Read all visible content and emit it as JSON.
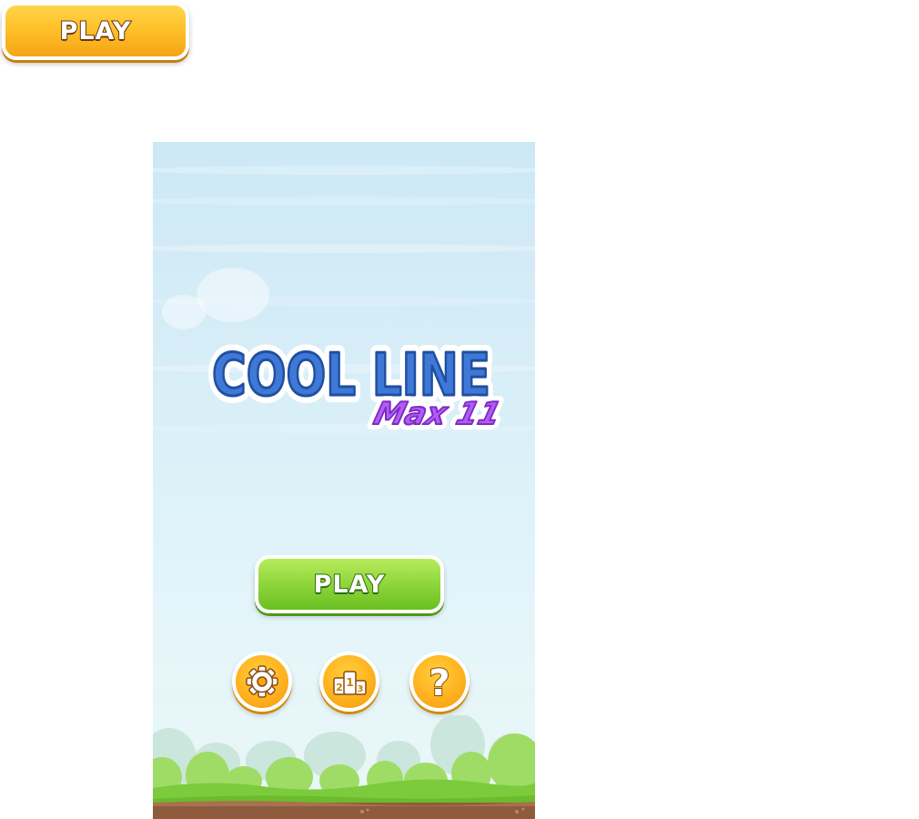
{
  "top_button": {
    "label": "PLAY"
  },
  "game": {
    "logo": {
      "line1": "COOL LINE",
      "line2": "Max 11"
    },
    "play_button": {
      "label": "PLAY"
    },
    "icons": {
      "settings": "gear-icon",
      "leaderboard": "podium-icon",
      "help": "question-icon"
    },
    "leaderboard_digits": [
      "2",
      "1",
      "3"
    ],
    "help_glyph": "?"
  },
  "colors": {
    "orange": "#ffb21f",
    "green": "#8ed63a",
    "logo_blue": "#3f78d6",
    "logo_purple": "#a647f0",
    "sky": "#d9eff8",
    "grass": "#7ccb3c",
    "dirt": "#8e5b3e"
  }
}
